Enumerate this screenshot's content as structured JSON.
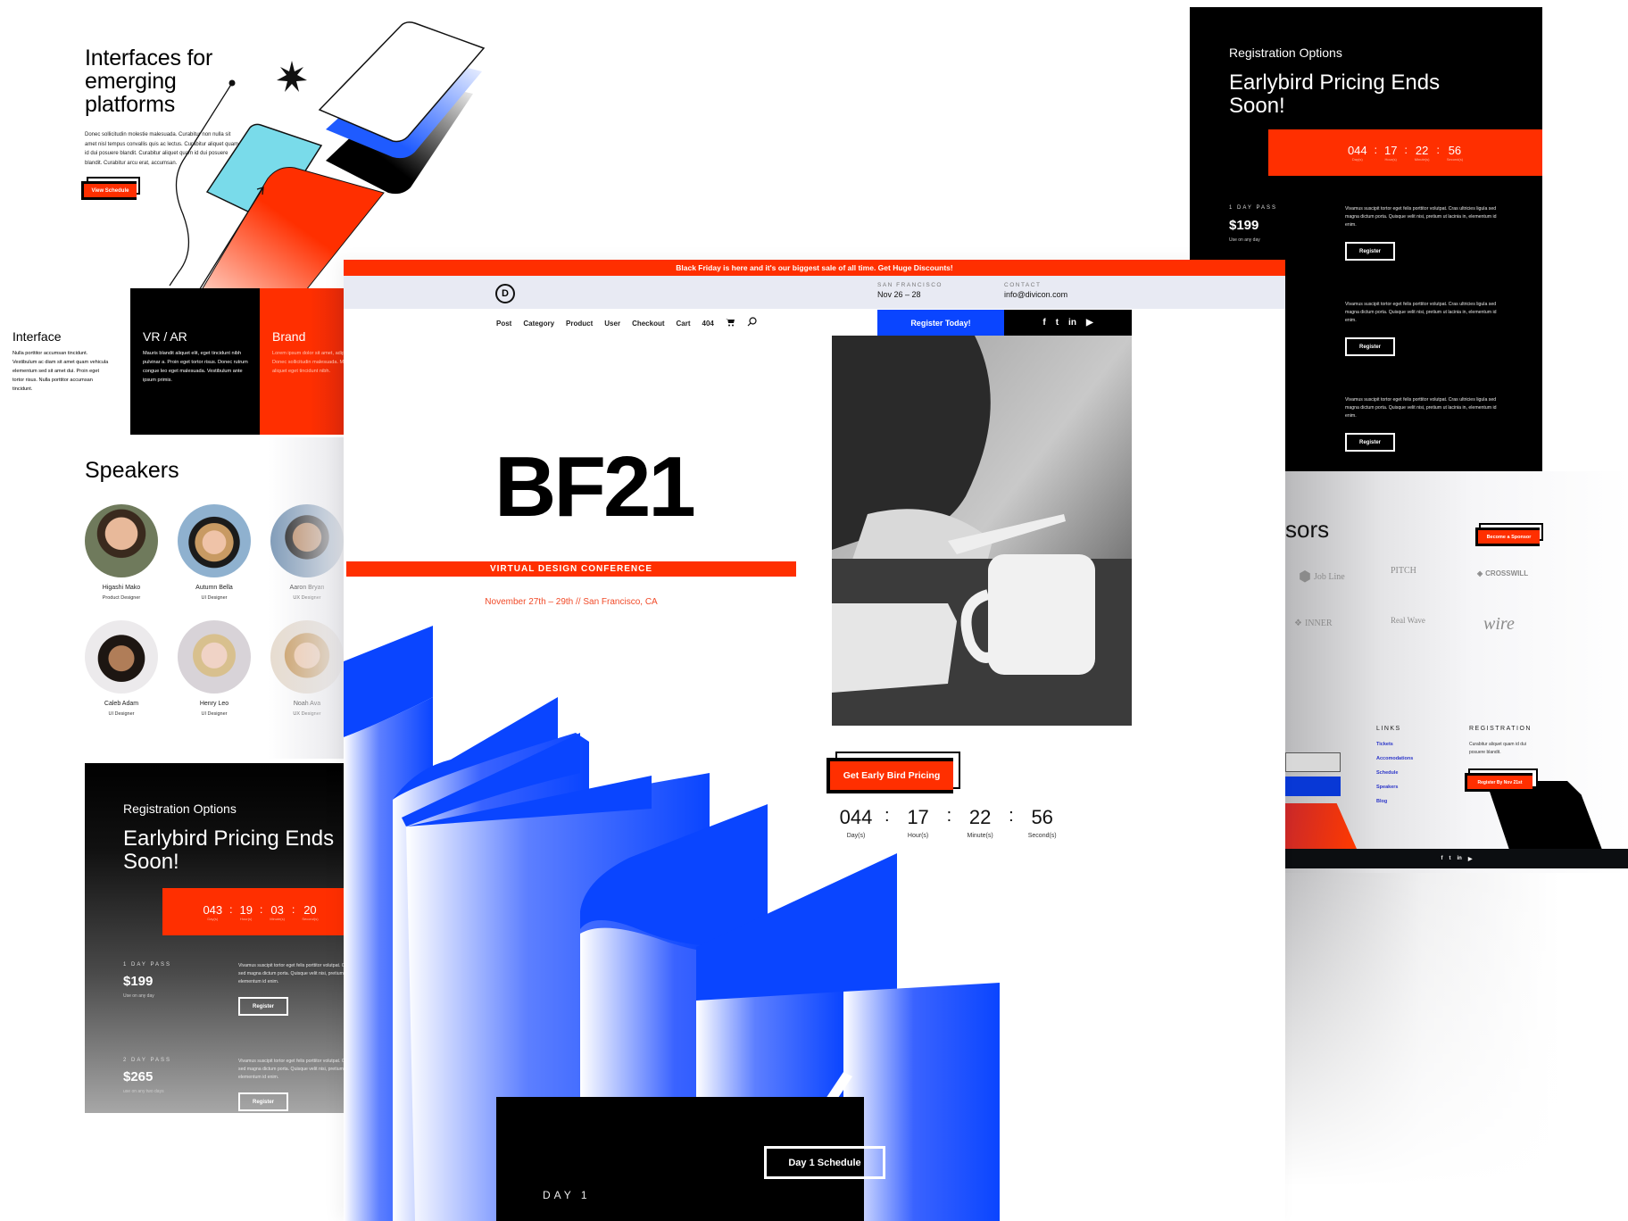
{
  "top_left": {
    "title": "Interfaces for emerging platforms",
    "body": "Donec sollicitudin molestie malesuada. Curabitur non nulla sit amet nisl tempus convallis quis ac lectus. Curabitur aliquet quam id dui posuere blandit. Curabitur aliquet quam id dui posuere blandit. Curabitur arcu erat, accumsan.",
    "button": "View Schedule"
  },
  "categories": [
    {
      "title": "Interface",
      "body": "Nulla porttitor accumsan tincidunt. Vestibulum ac diam sit amet quam vehicula elementum sed sit amet dui. Proin eget tortor risus. Nulla porttitor accumsan tincidunt."
    },
    {
      "title": "VR / AR",
      "body": "Mauris blandit aliquet elit, eget tincidunt nibh pulvinar a. Proin eget tortor risus. Donec rutrum congue leo eget malesuada. Vestibulum ante ipsum primis."
    },
    {
      "title": "Brand",
      "body": "Lorem ipsum dolor sit amet, adipiscing elit. Donec sollicitudin malesuada. Mauris blandit aliquet eget tincidunt nibh."
    }
  ],
  "speakers": {
    "heading": "Speakers",
    "items": [
      {
        "name": "Higashi Mako",
        "role": "Product Designer"
      },
      {
        "name": "Autumn Bella",
        "role": "UI Designer"
      },
      {
        "name": "Aaron Bryan",
        "role": "UX Designer"
      },
      {
        "name": "Caleb Adam",
        "role": "UI Designer"
      },
      {
        "name": "Henry Leo",
        "role": "UI Designer"
      },
      {
        "name": "Noah Ava",
        "role": "UX Designer"
      }
    ]
  },
  "reg_lower_left": {
    "subtitle": "Registration Options",
    "title": "Earlybird Pricing Ends Soon!",
    "countdown": [
      {
        "value": "043",
        "label": "Day(s)"
      },
      {
        "value": "19",
        "label": "Hour(s)"
      },
      {
        "value": "03",
        "label": "Minute(s)"
      },
      {
        "value": "20",
        "label": "Second(s)"
      }
    ],
    "passes": [
      {
        "label": "1 DAY PASS",
        "price": "$199",
        "note": "Use on any day",
        "desc": "Vivamus suscipit tortor eget felis porttitor volutpat. Cras ultricies ligula sed magna dictum porta. Quisque velit nisi, pretium ut lacinia in, elementum id enim.",
        "button": "Register"
      },
      {
        "label": "2 DAY PASS",
        "price": "$265",
        "note": "use on any two days",
        "desc": "Vivamus suscipit tortor eget felis porttitor volutpat. Cras ultricies ligula sed magna dictum porta. Quisque velit nisi, pretium ut lacinia in, elementum id enim.",
        "button": "Register"
      }
    ]
  },
  "main": {
    "promo_bar": "Black Friday is here and it's our biggest sale of all time. Get Huge Discounts!",
    "logo": "D",
    "location_label": "SAN FRANCISCO",
    "location_value": "Nov 26 – 28",
    "contact_label": "CONTACT",
    "contact_value": "info@divicon.com",
    "nav": [
      "Post",
      "Category",
      "Product",
      "User",
      "Checkout",
      "Cart",
      "404"
    ],
    "register_button": "Register Today!",
    "social": [
      "f",
      "t",
      "in",
      "▶"
    ],
    "hero_title": "BF21",
    "hero_banner": "VIRTUAL DESIGN CONFERENCE",
    "hero_dates": "November 27th – 29th // San Francisco, CA",
    "cta_button": "Get Early Bird Pricing",
    "countdown": [
      {
        "value": "044",
        "label": "Day(s)"
      },
      {
        "value": "17",
        "label": "Hour(s)"
      },
      {
        "value": "22",
        "label": "Minute(s)"
      },
      {
        "value": "56",
        "label": "Second(s)"
      }
    ],
    "schedule_day": "DAY 1",
    "schedule_button": "Day 1 Schedule"
  },
  "reg_top_right": {
    "subtitle": "Registration Options",
    "title": "Earlybird Pricing Ends Soon!",
    "countdown": [
      {
        "value": "044",
        "label": "Day(s)"
      },
      {
        "value": "17",
        "label": "Hour(s)"
      },
      {
        "value": "22",
        "label": "Minute(s)"
      },
      {
        "value": "56",
        "label": "Second(s)"
      }
    ],
    "pass_label": "1 DAY PASS",
    "pass_price": "$199",
    "pass_note": "Use on any day",
    "desc": "Vivamus suscipit tortor eget felis porttitor volutpat. Cras ultricies ligula sed magna dictum porta. Quisque velit nisi, pretium ut lacinia in, elementum id enim.",
    "button": "Register"
  },
  "sponsors": {
    "heading_partial": "sors",
    "button": "Become a Sponsor",
    "logos": [
      "Job Line",
      "PITCH",
      "CROSSWILL",
      "INNER",
      "Real Wave",
      "wire"
    ]
  },
  "footer": {
    "links_heading": "LINKS",
    "links": [
      "Tickets",
      "Accomodations",
      "Schedule",
      "Speakers",
      "Blog"
    ],
    "registration_heading": "REGISTRATION",
    "registration_text": "Curabitur aliquet quam id dui posuere blandit.",
    "registration_button": "Register By Nov 21st",
    "social": [
      "f",
      "t",
      "in",
      "▶"
    ]
  },
  "colors": {
    "accent_red": "#ff2f00",
    "accent_blue": "#0a45ff",
    "header_gray": "#e8eaf3",
    "link_blue": "#2c36c9"
  }
}
